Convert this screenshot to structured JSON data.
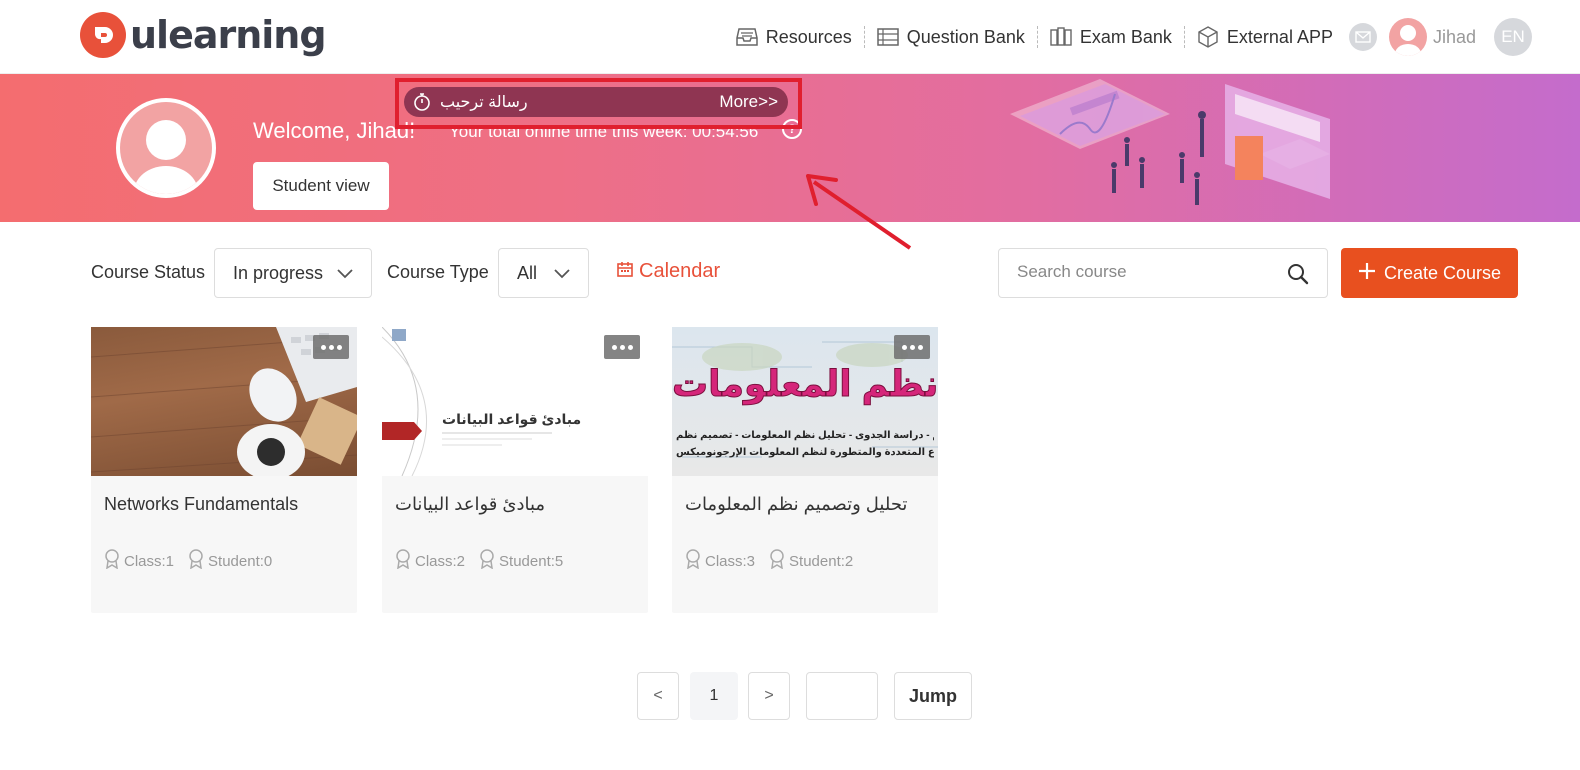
{
  "app": {
    "logo_text": "ulearning"
  },
  "nav": {
    "resources": "Resources",
    "question_bank": "Question Bank",
    "exam_bank": "Exam Bank",
    "external_app": "External APP",
    "user_name": "Jihad",
    "language": "EN"
  },
  "banner": {
    "welcome": "Welcome, Jihad!",
    "online_time": "Your total online time this week: 00:54:56",
    "help": "?",
    "student_view": "Student view",
    "message": "رسالة ترحيب",
    "more": "More>>"
  },
  "filters": {
    "status_label": "Course Status",
    "status_value": "In progress",
    "type_label": "Course Type",
    "type_value": "All",
    "calendar": "Calendar",
    "search_placeholder": "Search course",
    "create_course": "Create Course"
  },
  "courses": [
    {
      "title": "Networks Fundamentals",
      "class": "Class:1",
      "student": "Student:0"
    },
    {
      "title": "مبادئ قواعد البيانات",
      "class": "Class:2",
      "student": "Student:5",
      "cover_title": "مبادئ قواعد البيانات"
    },
    {
      "title": "تحليل وتصميم نظم المعلومات",
      "class": "Class:3",
      "student": "Student:2",
      "cover_title": "تصميم نظم المعلومات",
      "cover_sub1": "نظرية النظم - دراسة الجدوى - تحليل نظم المعلومات - تصميم نظم",
      "cover_sub2": "المعلومات - الأنواع المتعددة والمتطورة لنظم المعلومات الإرجونوميكس"
    }
  ],
  "pagination": {
    "prev": "<",
    "current": "1",
    "next": ">",
    "jump": "Jump"
  },
  "colors": {
    "accent": "#e8501f",
    "highlight_frame": "#e01f2e"
  }
}
